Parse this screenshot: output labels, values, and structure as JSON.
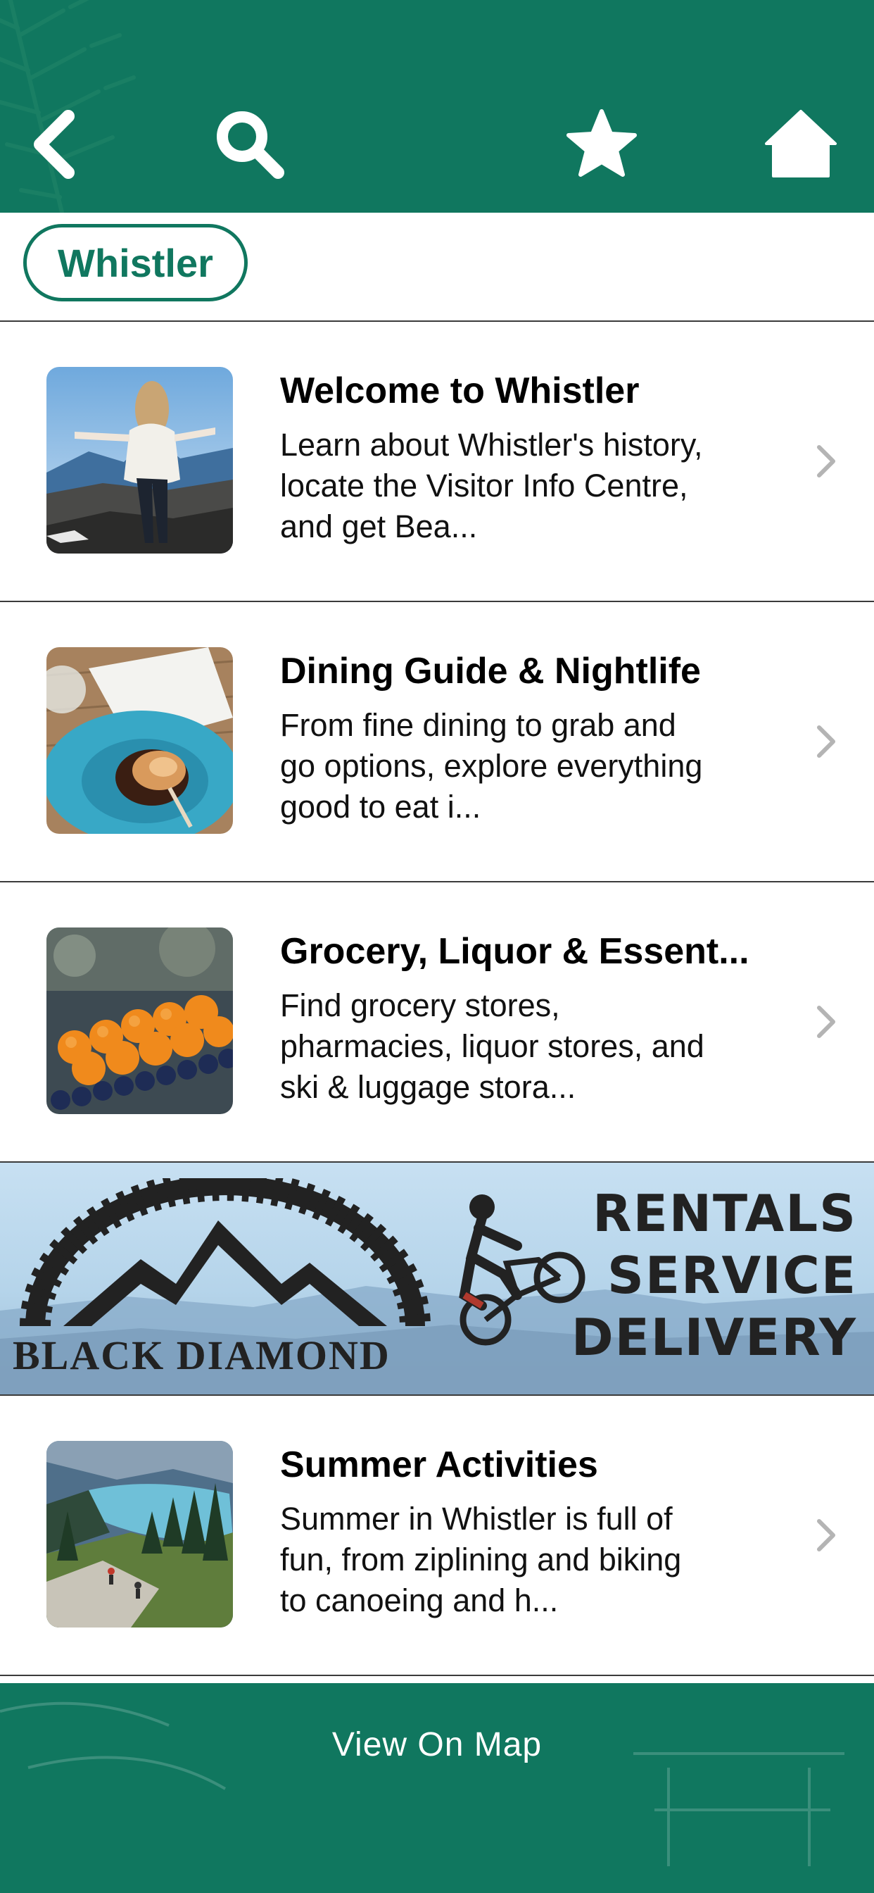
{
  "colors": {
    "brand_green": "#10775f",
    "divider": "#3b3b3b",
    "chevron": "#b4b4b4"
  },
  "header": {
    "icons": [
      "back-icon",
      "search-icon",
      "star-icon",
      "home-icon"
    ]
  },
  "location_chip": {
    "label": "Whistler"
  },
  "items": [
    {
      "title": "Welcome to Whistler",
      "description": "Learn about Whistler's history, locate the Visitor Info Centre, and get Bea...",
      "image": "person on mountain summit photo"
    },
    {
      "title": "Dining Guide & Nightlife",
      "description": "From fine dining to grab and go options, explore everything good to eat i...",
      "image": "plated dish photo"
    },
    {
      "title": "Grocery, Liquor & Essent...",
      "description": "Find grocery stores, pharmacies, liquor stores, and ski & luggage stora...",
      "image": "oranges and blueberries photo"
    },
    {
      "title": "Summer Activities",
      "description": "Summer in Whistler is full of fun, from ziplining and biking to canoeing and h...",
      "image": "hikers above alpine lake photo"
    }
  ],
  "banner": {
    "brand": "BLACK DIAMOND",
    "lines": [
      "RENTALS",
      "SERVICE",
      "DELIVERY"
    ]
  },
  "footer": {
    "button_label": "View On Map"
  }
}
